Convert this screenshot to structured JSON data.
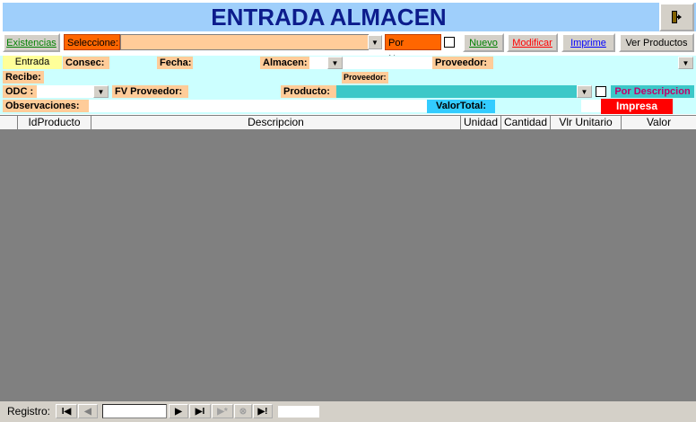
{
  "title": "ENTRADA ALMACEN",
  "toolbar": {
    "existencias": "Existencias",
    "seleccione": "Seleccione:",
    "por_numero": "Por Numero",
    "nuevo": "Nuevo",
    "modificar": "Modificar",
    "imprime": "Imprime",
    "ver_productos": "Ver Productos"
  },
  "form": {
    "entrada": "Entrada",
    "consec": "Consec:",
    "fecha": "Fecha:",
    "almacen": "Almacen:",
    "proveedor": "Proveedor:",
    "recibe": "Recibe:",
    "proveedor_small": "Proveedor:",
    "odc": "ODC :",
    "fv_proveedor": "FV Proveedor:",
    "producto": "Producto:",
    "por_descripcion": "Por Descripcion",
    "observaciones": "Observaciones:",
    "valor_total": "ValorTotal:",
    "impresa": "Impresa"
  },
  "grid": {
    "columns": [
      "IdProducto",
      "Descripcion",
      "Unidad",
      "Cantidad",
      "Vlr Unitario",
      "Valor"
    ]
  },
  "nav": {
    "registro": "Registro:"
  },
  "colors": {
    "title_bg": "#9fcffb",
    "title_text": "#0c1c8c",
    "label_orange": "#ffcc99",
    "row_cyan": "#ccffff",
    "impresa_red": "#ff0000",
    "valor_total_blue": "#33ccff"
  }
}
